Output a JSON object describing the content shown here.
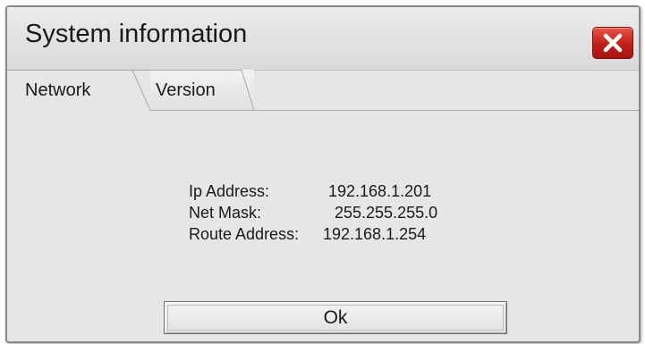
{
  "window": {
    "title": "System information",
    "close_icon": "close-icon",
    "close_color": "#c8231b"
  },
  "tabs": [
    {
      "label": "Network",
      "active": true
    },
    {
      "label": "Version",
      "active": false
    }
  ],
  "network": {
    "ip_label": "Ip Address:",
    "ip_value": "192.168.1.201",
    "mask_label": "Net Mask:",
    "mask_value": "255.255.255.0",
    "route_label": "Route Address:",
    "route_value": "192.168.1.254"
  },
  "buttons": {
    "ok_label": "Ok"
  }
}
